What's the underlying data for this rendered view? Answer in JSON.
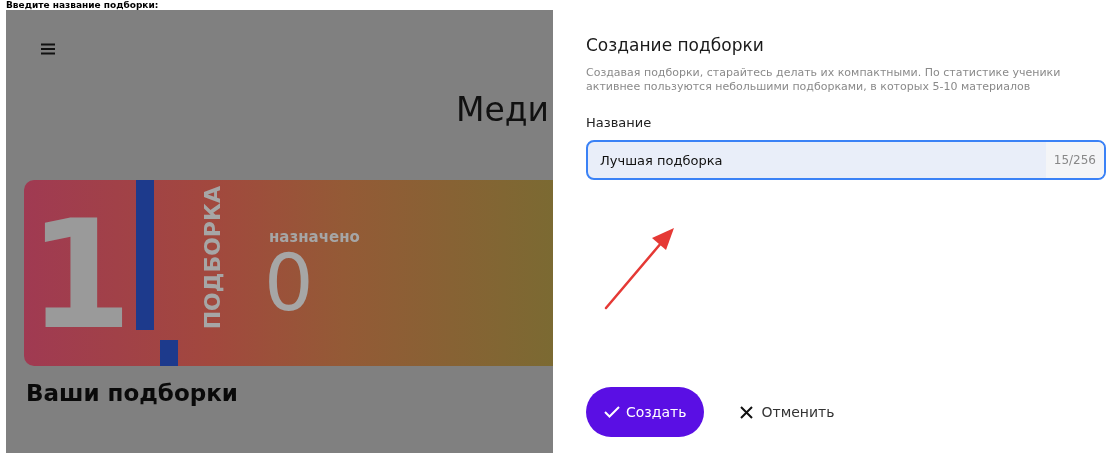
{
  "caption": "Введите название подборки:",
  "background_page": {
    "heading": "Меди",
    "card": {
      "number": "1",
      "label": "ПОДБОРКА",
      "assigned_label": "назначено",
      "assigned_count": "0"
    },
    "section_title": "Ваши подборки"
  },
  "dialog": {
    "title": "Создание подборки",
    "description": "Создавая подборки, старайтесь делать их компактными. По статистике ученики активнее пользуются небольшими подборками, в которых 5-10 материалов",
    "field": {
      "label": "Название",
      "value": "Лучшая подборка",
      "counter": "15/256",
      "focused": true
    },
    "buttons": [
      {
        "kind": "primary",
        "label": "Создать"
      },
      {
        "kind": "secondary",
        "label": "Отменить"
      }
    ]
  }
}
